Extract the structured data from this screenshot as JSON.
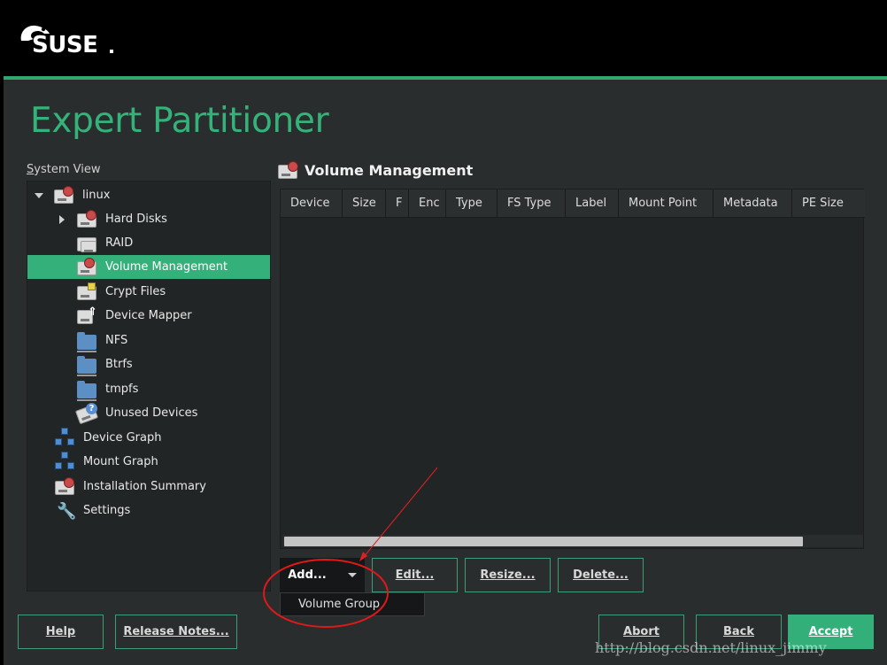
{
  "brand": {
    "logo_text": "SUSE",
    "accent": "#35b27a",
    "background": "#2a2d2e"
  },
  "page": {
    "title": "Expert Partitioner"
  },
  "system_view": {
    "label": "System View",
    "items": [
      {
        "label": "linux",
        "icon": "hard-disk-icon"
      },
      {
        "label": "Hard Disks",
        "icon": "hard-disk-icon"
      },
      {
        "label": "RAID",
        "icon": "raid-icon"
      },
      {
        "label": "Volume Management",
        "icon": "volume-icon",
        "selected": true
      },
      {
        "label": "Crypt Files",
        "icon": "crypt-icon"
      },
      {
        "label": "Device Mapper",
        "icon": "device-mapper-icon"
      },
      {
        "label": "NFS",
        "icon": "folder-icon"
      },
      {
        "label": "Btrfs",
        "icon": "folder-icon"
      },
      {
        "label": "tmpfs",
        "icon": "folder-icon"
      },
      {
        "label": "Unused Devices",
        "icon": "unused-devices-icon"
      },
      {
        "label": "Device Graph",
        "icon": "graph-icon"
      },
      {
        "label": "Mount Graph",
        "icon": "graph-icon"
      },
      {
        "label": "Installation Summary",
        "icon": "summary-icon"
      },
      {
        "label": "Settings",
        "icon": "wrench-icon"
      }
    ]
  },
  "main": {
    "title": "Volume Management",
    "columns": [
      "Device",
      "Size",
      "F",
      "Enc",
      "Type",
      "FS Type",
      "Label",
      "Mount Point",
      "Metadata",
      "PE Size"
    ],
    "rows": []
  },
  "actions": {
    "add": "Add...",
    "edit": "Edit...",
    "resize": "Resize...",
    "delete": "Delete...",
    "menu_item": "Volume Group"
  },
  "footer": {
    "help": "Help",
    "release_notes": "Release Notes...",
    "abort": "Abort",
    "back": "Back",
    "accept": "Accept"
  },
  "watermark": "http://blog.csdn.net/linux_jimmy"
}
